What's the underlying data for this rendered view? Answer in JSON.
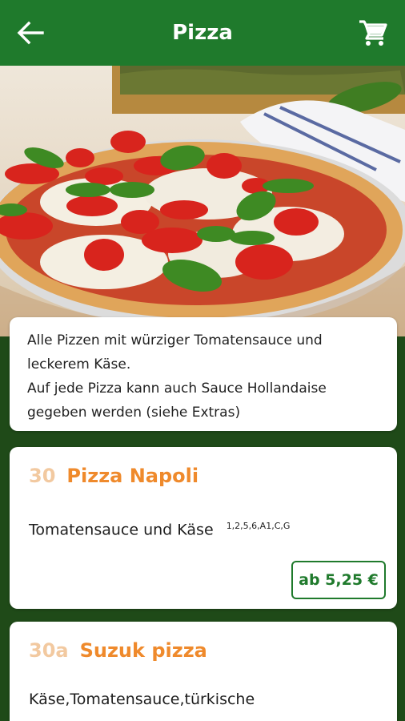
{
  "header": {
    "title": "Pizza",
    "back_icon": "arrow-left-icon",
    "cart_icon": "shopping-cart-icon",
    "background_color": "#1f7a2c"
  },
  "intro": {
    "lines": [
      "Alle Pizzen mit würziger Tomatensauce und",
      "leckerem Käse.",
      "Auf jede Pizza kann auch Sauce Hollandaise",
      "gegeben werden (siehe Extras)"
    ]
  },
  "items": [
    {
      "number": "30",
      "name": "Pizza Napoli",
      "description": "Tomatensauce und Käse",
      "allergens": "1,2,5,6,A1,C,G",
      "price_label": "ab 5,25 €"
    },
    {
      "number": "30a",
      "name": "Suzuk pizza",
      "description": "Käse,Tomatensauce,türkische"
    }
  ],
  "colors": {
    "accent_green": "#1f7a2c",
    "item_name_orange": "#ef8a2c",
    "item_number_peach": "#f2c9a0",
    "page_background": "#1f4a18"
  }
}
